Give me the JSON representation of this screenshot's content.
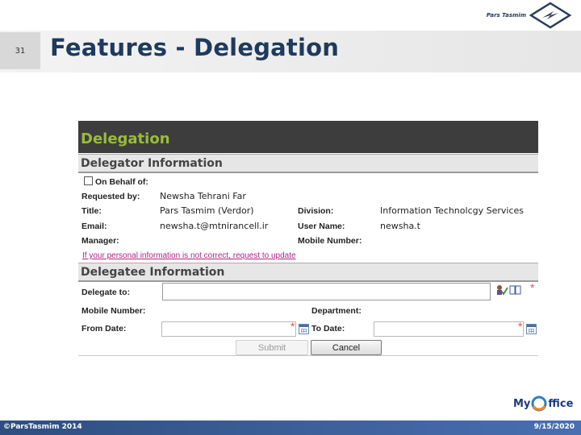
{
  "brand": {
    "name": "Pars Tasmim"
  },
  "slide": {
    "number": "31",
    "title": "Features - Delegation"
  },
  "form": {
    "header": "Delegation",
    "delegator": {
      "section_title": "Delegator Information",
      "on_behalf_label": "On Behalf of:",
      "requested_by_label": "Requested by:",
      "requested_by_value": "Newsha Tehrani Far",
      "title_label": "Title:",
      "title_value": "Pars Tasmim (Verdor)",
      "division_label": "Division:",
      "division_value": "Information Technolcgy Services",
      "email_label": "Email:",
      "email_value": "newsha.t@mtnirancell.ir",
      "username_label": "User Name:",
      "username_value": "newsha.t",
      "manager_label": "Manager:",
      "mobile_label": "Mobile Number:",
      "update_link": "If your personal information is not correct, request to update"
    },
    "delegatee": {
      "section_title": "Delegatee Information",
      "delegate_to_label": "Delegate to:",
      "mobile_label": "Mobile Number:",
      "department_label": "Department:",
      "from_date_label": "From Date:",
      "to_date_label": "To Date:",
      "required_mark": "*"
    },
    "buttons": {
      "submit": "Submit",
      "cancel": "Cancel"
    }
  },
  "footer": {
    "copyright": "©ParsTasmim 2014",
    "date": "9/15/2020",
    "logo_my": "My",
    "logo_ffice": "ffice"
  },
  "colors": {
    "title": "#1e3a5c",
    "panel_header_bg": "#3d3d3d",
    "panel_header_text": "#9bbb3c",
    "link": "#b0208a",
    "footer": "#2e4e80"
  }
}
